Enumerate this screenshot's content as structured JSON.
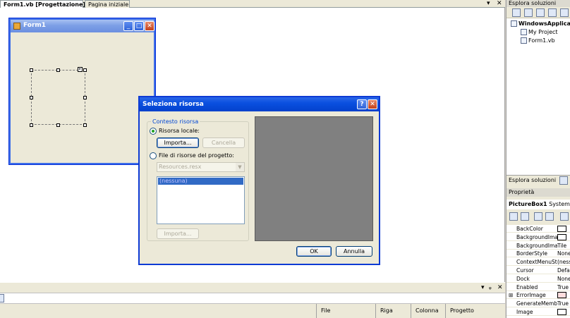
{
  "tabs": {
    "design": "Form1.vb [Progettazione]*",
    "start": "Pagina iniziale",
    "dropdown_icon": "chevron-down-icon",
    "close_icon": "close-icon"
  },
  "form": {
    "title": "Form1",
    "minimize": "_",
    "maximize": "□",
    "close": "✕"
  },
  "dialog": {
    "title": "Seleziona risorsa",
    "help": "?",
    "close": "✕",
    "group_label": "Contesto risorsa",
    "local_resource_label": "Risorsa locale:",
    "import_label": "Importa...",
    "cancel_label": "Cancella",
    "project_resource_label": "File di risorse del progetto:",
    "resx_value": "Resources.resx",
    "list_item": "(nessuna)",
    "import2_label": "Importa...",
    "ok_label": "OK",
    "annulla_label": "Annulla"
  },
  "status": {
    "file": "File",
    "riga": "Riga",
    "colonna": "Colonna",
    "progetto": "Progetto"
  },
  "solution": {
    "header": "Esplora soluzioni",
    "items": [
      {
        "label": "WindowsApplicat",
        "bold": true
      },
      {
        "label": "My Project",
        "bold": false
      },
      {
        "label": "Form1.vb",
        "bold": false
      }
    ],
    "tab_label": "Esplora soluzioni"
  },
  "properties": {
    "header": "Proprietà",
    "object_name": "PictureBox1",
    "object_type": "System.W",
    "rows": [
      {
        "name": "BackColor",
        "value": "",
        "swatch": true,
        "expand": false
      },
      {
        "name": "BackgroundImag",
        "value": "",
        "swatch": true,
        "expand": false
      },
      {
        "name": "BackgroundImag",
        "value": "Tile",
        "swatch": false,
        "expand": false
      },
      {
        "name": "BorderStyle",
        "value": "None",
        "swatch": false,
        "expand": false
      },
      {
        "name": "ContextMenuStr",
        "value": "(ness",
        "swatch": false,
        "expand": false
      },
      {
        "name": "Cursor",
        "value": "Defau",
        "swatch": false,
        "expand": false
      },
      {
        "name": "Dock",
        "value": "None",
        "swatch": false,
        "expand": false
      },
      {
        "name": "Enabled",
        "value": "True",
        "swatch": false,
        "expand": false
      },
      {
        "name": "ErrorImage",
        "value": "",
        "swatch": true,
        "expand": true
      },
      {
        "name": "GenerateMembe",
        "value": "True",
        "swatch": false,
        "expand": false
      },
      {
        "name": "Image",
        "value": "",
        "swatch": true,
        "expand": false
      }
    ]
  }
}
